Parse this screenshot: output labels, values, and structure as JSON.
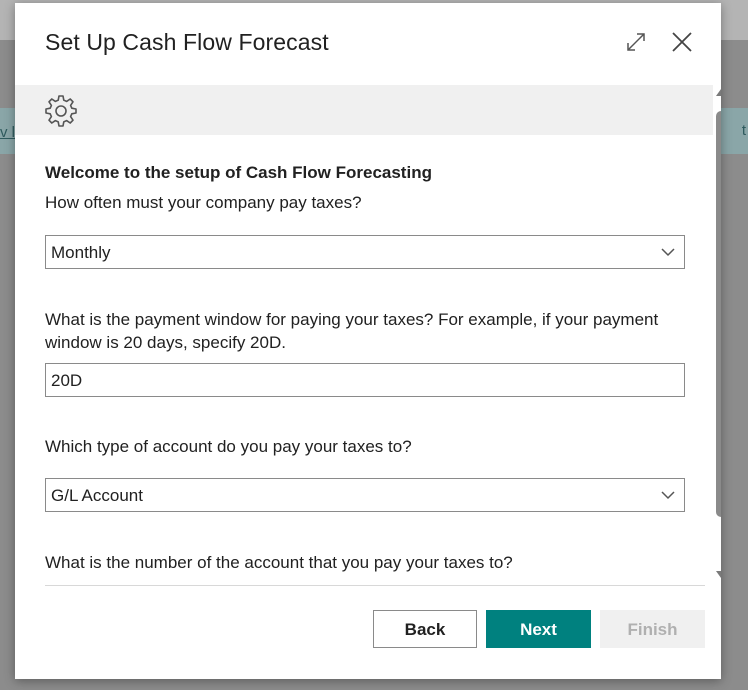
{
  "background": {
    "left_fragment": "v l",
    "right_fragment": "t"
  },
  "dialog": {
    "title": "Set Up Cash Flow Forecast",
    "icons": {
      "expand": "expand-icon",
      "close": "close-icon",
      "settings": "gear-icon"
    },
    "welcome": "Welcome to the setup of Cash Flow Forecasting",
    "questions": {
      "tax_frequency_label": "How often must your company pay taxes?",
      "tax_frequency_value": "Monthly",
      "payment_window_label": "What is the payment window for paying your taxes? For example, if your payment window is 20 days, specify 20D.",
      "payment_window_value": "20D",
      "account_type_label": "Which type of account do you pay your taxes to?",
      "account_type_value": "G/L Account",
      "account_number_label": "What is the number of the account that you pay your taxes to?"
    },
    "buttons": {
      "back": "Back",
      "next": "Next",
      "finish": "Finish"
    },
    "colors": {
      "primary": "#00817f",
      "disabled_bg": "#f0f0f0",
      "disabled_text": "#b0b0b0"
    }
  }
}
